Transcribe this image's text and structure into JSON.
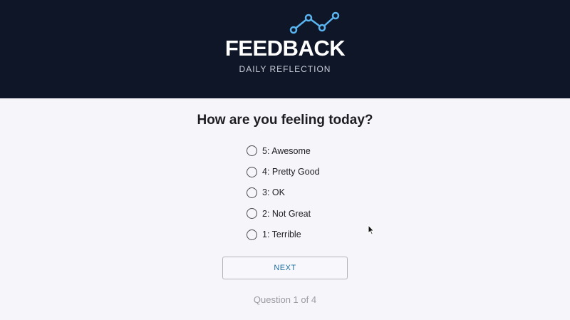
{
  "header": {
    "logo_icon": "line-chart-icon",
    "title": "FEEDBACK",
    "subtitle": "DAILY REFLECTION"
  },
  "survey": {
    "question": "How are you feeling today?",
    "options": [
      {
        "label": "5: Awesome",
        "selected": false
      },
      {
        "label": "4: Pretty Good",
        "selected": false
      },
      {
        "label": "3: OK",
        "selected": false
      },
      {
        "label": "2: Not Great",
        "selected": false
      },
      {
        "label": "1: Terrible",
        "selected": false
      }
    ],
    "next_label": "NEXT",
    "progress_text": "Question 1 of 4"
  },
  "colors": {
    "header_bg": "#0f1628",
    "logo_accent": "#5ab4f0",
    "page_bg": "#f5f5fa",
    "button_text": "#1f6ea0"
  }
}
